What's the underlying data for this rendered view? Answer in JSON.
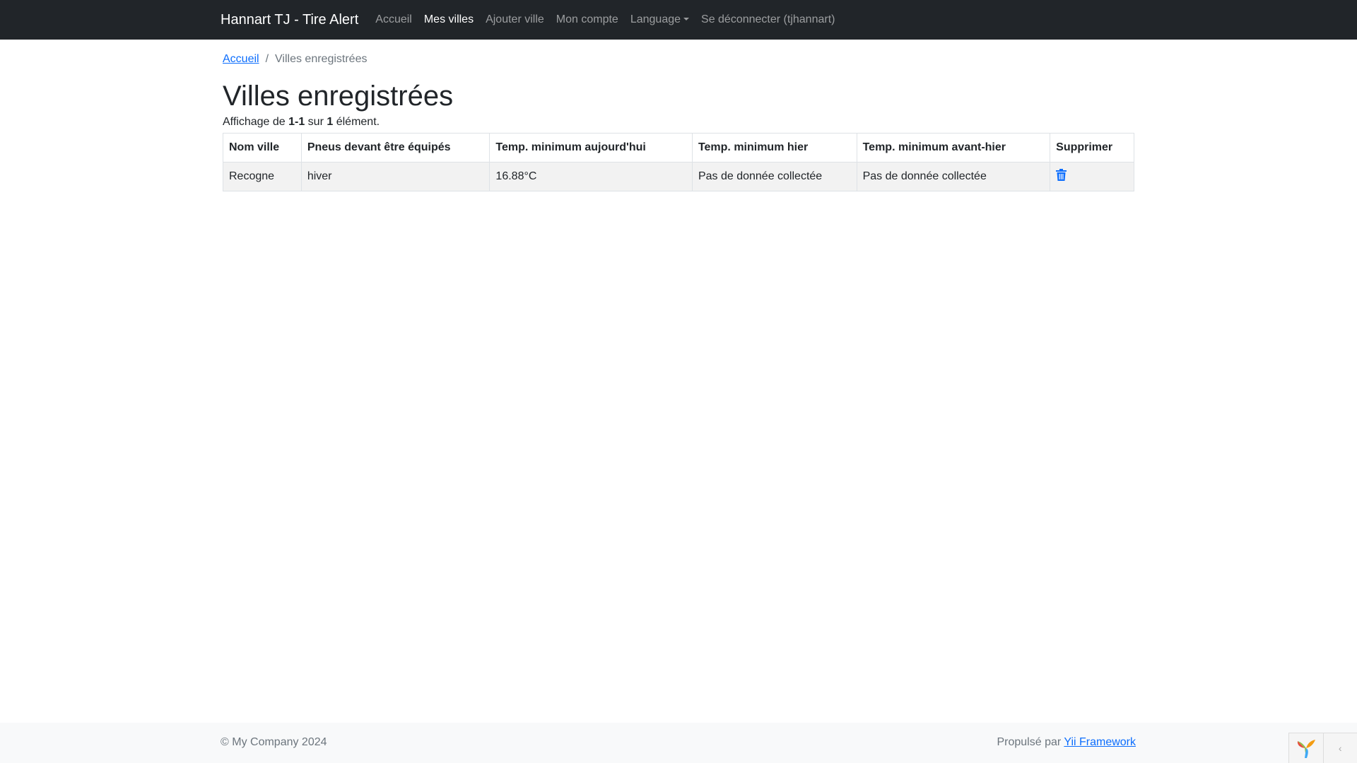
{
  "nav": {
    "brand": "Hannart TJ - Tire Alert",
    "items": [
      {
        "label": "Accueil",
        "active": false
      },
      {
        "label": "Mes villes",
        "active": true
      },
      {
        "label": "Ajouter ville",
        "active": false
      },
      {
        "label": "Mon compte",
        "active": false
      },
      {
        "label": "Language",
        "active": false
      },
      {
        "label": "Se déconnecter (tjhannart)",
        "active": false
      }
    ]
  },
  "breadcrumb": {
    "home": "Accueil",
    "separator": "/",
    "current": "Villes enregistrées"
  },
  "page_title": "Villes enregistrées",
  "summary": {
    "prefix": "Affichage de ",
    "range": "1-1",
    "middle": " sur ",
    "total": "1",
    "suffix": " élément."
  },
  "table": {
    "headers": [
      "Nom ville",
      "Pneus devant être équipés",
      "Temp. minimum aujourd'hui",
      "Temp. minimum hier",
      "Temp. minimum avant-hier",
      "Supprimer"
    ],
    "rows": [
      [
        "Recogne",
        "hiver",
        "16.88°C",
        "Pas de donnée collectée",
        "Pas de donnée collectée"
      ]
    ],
    "delete_icon": "trash-icon"
  },
  "footer": {
    "copyright": "© My Company 2024",
    "powered_prefix": "Propulsé par ",
    "powered_link": "Yii Framework"
  },
  "colors": {
    "navbar_bg": "#212529",
    "link": "#0d6efd",
    "row_bg": "#f2f2f2"
  }
}
